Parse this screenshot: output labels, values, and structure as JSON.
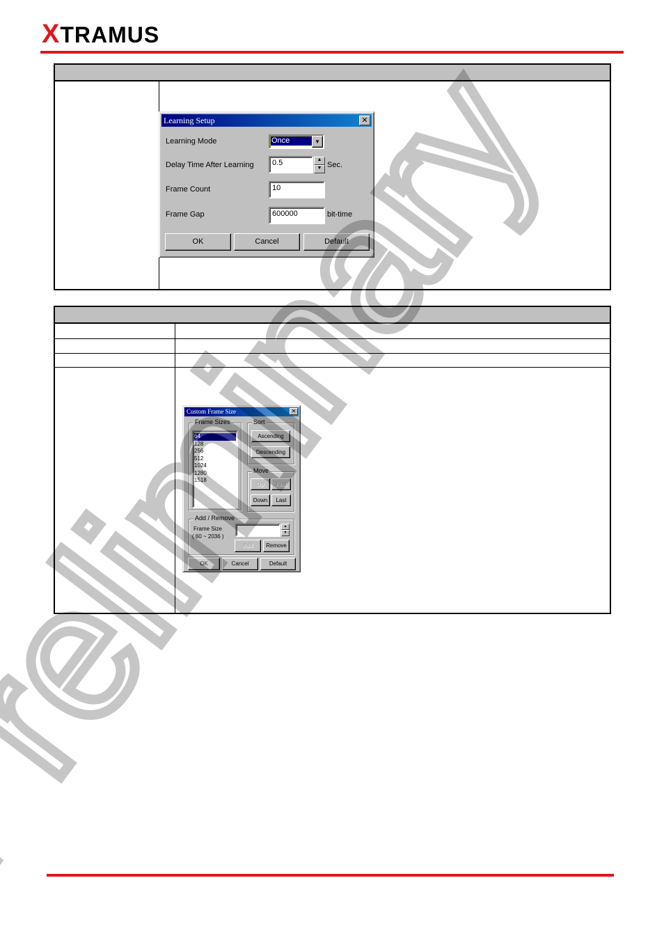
{
  "header": {
    "logo_mark": "X",
    "logo_text": "TRAMUS"
  },
  "learning_setup": {
    "title": "Learning Setup",
    "close": "✕",
    "fields": {
      "learning_mode": {
        "label": "Learning Mode",
        "value": "Once"
      },
      "delay_time": {
        "label": "Delay Time After Learning",
        "value": "0.5",
        "unit": "Sec."
      },
      "frame_count": {
        "label": "Frame Count",
        "value": "10"
      },
      "frame_gap": {
        "label": "Frame Gap",
        "value": "600000",
        "unit": "bit-time"
      }
    },
    "buttons": {
      "ok": "OK",
      "cancel": "Cancel",
      "default": "Default"
    }
  },
  "custom_frame_size": {
    "title": "Custom Frame Size",
    "close": "✕",
    "frame_sizes_label": "Frame Sizes",
    "frame_sizes": [
      "64",
      "128",
      "256",
      "512",
      "1024",
      "1280",
      "1518"
    ],
    "selected_index": 0,
    "sort": {
      "label": "Sort",
      "ascending": "Ascending",
      "descending": "Descending"
    },
    "move": {
      "label": "Move",
      "up": "Up",
      "first": "First",
      "down": "Down",
      "last": "Last"
    },
    "add_remove": {
      "label": "Add / Remove",
      "frame_size_label": "Frame Size",
      "range": "( 60 ~ 2036 )",
      "value": "",
      "add": "Add",
      "remove": "Remove"
    },
    "buttons": {
      "ok": "OK",
      "cancel": "Cancel",
      "default": "Default"
    }
  },
  "watermark": "Preliminary",
  "colors": {
    "brand_red": "#e0161d",
    "titlebar": "#000080",
    "dialog_face": "#c0c0c0"
  }
}
